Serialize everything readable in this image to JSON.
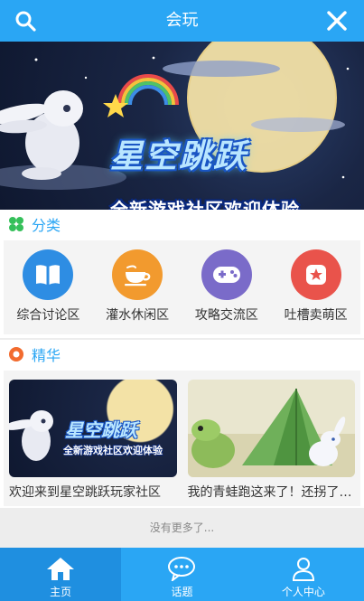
{
  "header": {
    "title": "会玩"
  },
  "banner": {
    "title": "星空跳跃",
    "subtitle": "全新游戏社区欢迎体验"
  },
  "categories": {
    "heading": "分类",
    "items": [
      {
        "label": "综合讨论区",
        "icon": "book-icon",
        "color": "#2e8de3"
      },
      {
        "label": "灌水休闲区",
        "icon": "coffee-cup-icon",
        "color": "#f29a2e"
      },
      {
        "label": "攻略交流区",
        "icon": "gamepad-icon",
        "color": "#7a6bc9"
      },
      {
        "label": "吐槽卖萌区",
        "icon": "star-badge-icon",
        "color": "#e9534b"
      }
    ]
  },
  "featured": {
    "heading": "精华",
    "items": [
      {
        "label": "欢迎来到星空跳跃玩家社区",
        "thumb_title": "星空跳跃",
        "thumb_subtitle": "全新游戏社区欢迎体验"
      },
      {
        "label": "我的青蛙跑这来了！还拐了…"
      }
    ]
  },
  "footer_note": "没有更多了...",
  "tabs": [
    {
      "label": "主页",
      "icon": "home-icon",
      "active": true
    },
    {
      "label": "话题",
      "icon": "chat-bubble-icon",
      "active": false
    },
    {
      "label": "个人中心",
      "icon": "user-icon",
      "active": false
    }
  ],
  "colors": {
    "primary": "#2aa6f4",
    "section_heading": "#2aa6f4",
    "category_heading_icon": "#35c05a",
    "featured_heading_icon": "#f26b2e"
  }
}
